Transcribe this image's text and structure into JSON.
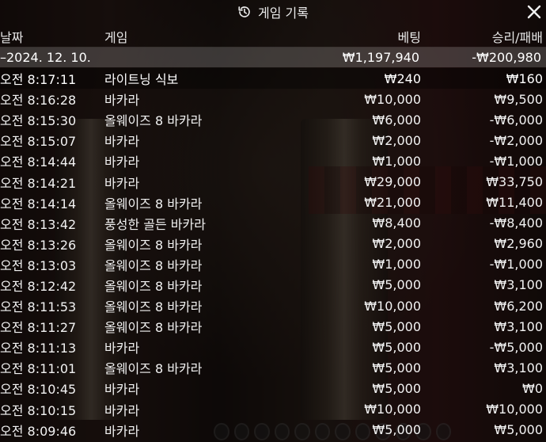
{
  "title": "게임 기록",
  "columns": {
    "date": "날짜",
    "game": "게임",
    "bet": "베팅",
    "result": "승리/패배"
  },
  "date_summary": {
    "date": "–2024. 12. 10.",
    "bet": "₩1,197,940",
    "result": "-₩200,980"
  },
  "rows": [
    {
      "time": "오전 8:17:11",
      "game": "라이트닝 식보",
      "bet": "₩240",
      "result": "₩160"
    },
    {
      "time": "오전 8:16:28",
      "game": "바카라",
      "bet": "₩10,000",
      "result": "₩9,500"
    },
    {
      "time": "오전 8:15:30",
      "game": "올웨이즈 8 바카라",
      "bet": "₩6,000",
      "result": "-₩6,000"
    },
    {
      "time": "오전 8:15:07",
      "game": "바카라",
      "bet": "₩2,000",
      "result": "-₩2,000"
    },
    {
      "time": "오전 8:14:44",
      "game": "바카라",
      "bet": "₩1,000",
      "result": "-₩1,000"
    },
    {
      "time": "오전 8:14:21",
      "game": "바카라",
      "bet": "₩29,000",
      "result": "₩33,750"
    },
    {
      "time": "오전 8:14:14",
      "game": "올웨이즈 8 바카라",
      "bet": "₩21,000",
      "result": "₩11,400"
    },
    {
      "time": "오전 8:13:42",
      "game": "풍성한 골든 바카라",
      "bet": "₩8,400",
      "result": "-₩8,400"
    },
    {
      "time": "오전 8:13:26",
      "game": "올웨이즈 8 바카라",
      "bet": "₩2,000",
      "result": "₩2,960"
    },
    {
      "time": "오전 8:13:03",
      "game": "올웨이즈 8 바카라",
      "bet": "₩1,000",
      "result": "-₩1,000"
    },
    {
      "time": "오전 8:12:42",
      "game": "올웨이즈 8 바카라",
      "bet": "₩5,000",
      "result": "₩3,100"
    },
    {
      "time": "오전 8:11:53",
      "game": "올웨이즈 8 바카라",
      "bet": "₩10,000",
      "result": "₩6,200"
    },
    {
      "time": "오전 8:11:27",
      "game": "올웨이즈 8 바카라",
      "bet": "₩5,000",
      "result": "₩3,100"
    },
    {
      "time": "오전 8:11:13",
      "game": "바카라",
      "bet": "₩5,000",
      "result": "-₩5,000"
    },
    {
      "time": "오전 8:11:01",
      "game": "올웨이즈 8 바카라",
      "bet": "₩5,000",
      "result": "₩3,100"
    },
    {
      "time": "오전 8:10:45",
      "game": "바카라",
      "bet": "₩5,000",
      "result": "₩0"
    },
    {
      "time": "오전 8:10:15",
      "game": "바카라",
      "bet": "₩10,000",
      "result": "₩10,000"
    },
    {
      "time": "오전 8:09:46",
      "game": "바카라",
      "bet": "₩5,000",
      "result": "₩5,000"
    }
  ],
  "icons": {
    "title": "history-icon",
    "close": "close-icon"
  }
}
